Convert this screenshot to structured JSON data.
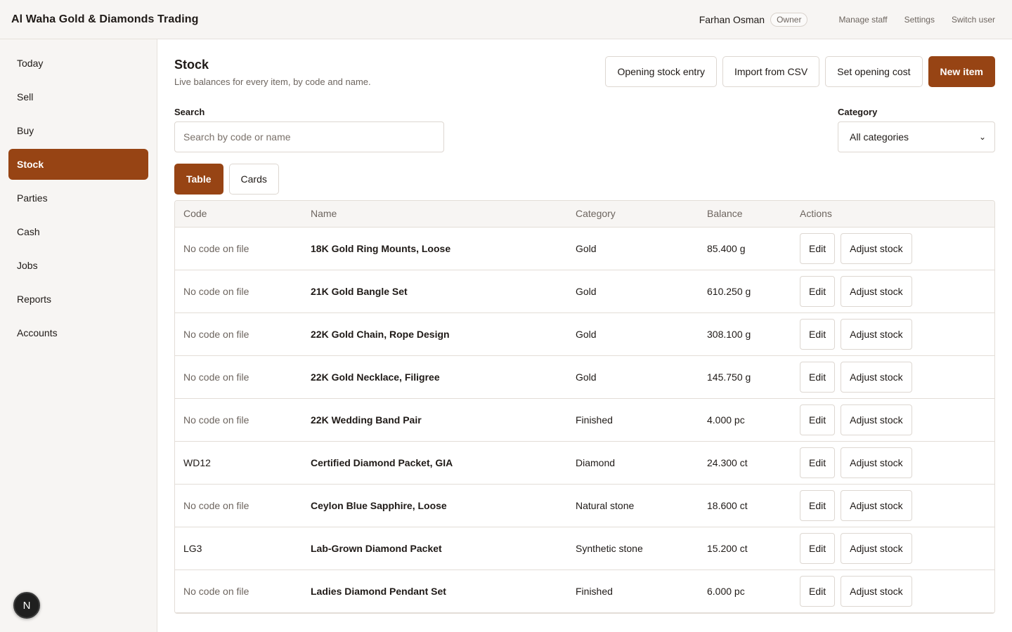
{
  "topbar": {
    "brand": "Al Waha Gold & Diamonds Trading",
    "user_name": "Farhan Osman",
    "role": "Owner",
    "links": [
      "Manage staff",
      "Settings",
      "Switch user"
    ]
  },
  "sidebar": {
    "items": [
      {
        "label": "Today"
      },
      {
        "label": "Sell"
      },
      {
        "label": "Buy"
      },
      {
        "label": "Stock",
        "active": true
      },
      {
        "label": "Parties"
      },
      {
        "label": "Cash"
      },
      {
        "label": "Jobs"
      },
      {
        "label": "Reports"
      },
      {
        "label": "Accounts"
      }
    ],
    "avatar_letter": "N"
  },
  "page": {
    "title": "Stock",
    "subtitle": "Live balances for every item, by code and name.",
    "actions": {
      "opening_stock": "Opening stock entry",
      "import_csv": "Import from CSV",
      "opening_cost": "Set opening cost",
      "new_item": "New item"
    }
  },
  "filters": {
    "search_label": "Search",
    "search_placeholder": "Search by code or name",
    "category_label": "Category",
    "category_value": "All categories"
  },
  "view_toggle": {
    "table": "Table",
    "cards": "Cards",
    "active": "table"
  },
  "table": {
    "columns": [
      "Code",
      "Name",
      "Category",
      "Balance",
      "Actions"
    ],
    "edit_label": "Edit",
    "adjust_label": "Adjust stock",
    "rows": [
      {
        "code": "No code on file",
        "has_code": false,
        "name": "18K Gold Ring Mounts, Loose",
        "category": "Gold",
        "balance": "85.400 g"
      },
      {
        "code": "No code on file",
        "has_code": false,
        "name": "21K Gold Bangle Set",
        "category": "Gold",
        "balance": "610.250 g"
      },
      {
        "code": "No code on file",
        "has_code": false,
        "name": "22K Gold Chain, Rope Design",
        "category": "Gold",
        "balance": "308.100 g"
      },
      {
        "code": "No code on file",
        "has_code": false,
        "name": "22K Gold Necklace, Filigree",
        "category": "Gold",
        "balance": "145.750 g"
      },
      {
        "code": "No code on file",
        "has_code": false,
        "name": "22K Wedding Band Pair",
        "category": "Finished",
        "balance": "4.000 pc"
      },
      {
        "code": "WD12",
        "has_code": true,
        "name": "Certified Diamond Packet, GIA",
        "category": "Diamond",
        "balance": "24.300 ct"
      },
      {
        "code": "No code on file",
        "has_code": false,
        "name": "Ceylon Blue Sapphire, Loose",
        "category": "Natural stone",
        "balance": "18.600 ct"
      },
      {
        "code": "LG3",
        "has_code": true,
        "name": "Lab-Grown Diamond Packet",
        "category": "Synthetic stone",
        "balance": "15.200 ct"
      },
      {
        "code": "No code on file",
        "has_code": false,
        "name": "Ladies Diamond Pendant Set",
        "category": "Finished",
        "balance": "6.000 pc"
      }
    ]
  },
  "colors": {
    "accent": "#974414",
    "sidebar_bg": "#f7f5f3",
    "border": "#e3ddd7",
    "muted_text": "#6d655f"
  }
}
